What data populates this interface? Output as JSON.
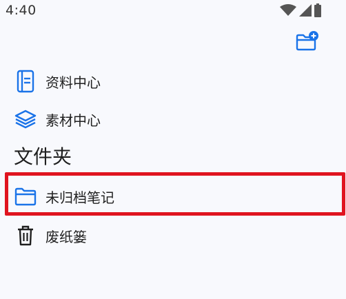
{
  "status_bar": {
    "time": "4:40",
    "icons": [
      "wifi-icon",
      "cell-signal-icon",
      "battery-icon"
    ]
  },
  "toolbar": {
    "new_folder_icon": "folder-plus-icon"
  },
  "nav": {
    "items": [
      {
        "label": "资料中心",
        "icon": "document-icon"
      },
      {
        "label": "素材中心",
        "icon": "layers-icon"
      }
    ]
  },
  "folders": {
    "heading": "文件夹",
    "items": [
      {
        "label": "未归档笔记",
        "icon": "folder-icon",
        "highlighted": true
      },
      {
        "label": "废纸篓",
        "icon": "trash-icon"
      }
    ]
  },
  "colors": {
    "accent": "#1a73e8",
    "highlight": "#e0141f",
    "background": "#f8f9fd"
  }
}
